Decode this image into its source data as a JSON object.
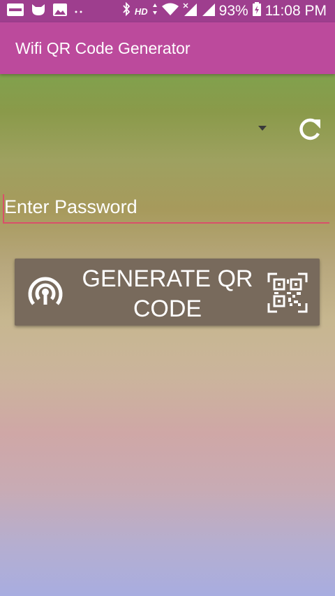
{
  "status_bar": {
    "battery": "93%",
    "time": "11:08 PM",
    "network_label": "HD",
    "icons": [
      "notification-icon",
      "cat-icon",
      "image-icon",
      "more-dots-icon",
      "bluetooth-icon",
      "data-arrows-icon",
      "wifi-signal-icon",
      "cell-signal-no-data-icon",
      "cell-signal-icon",
      "battery-icon"
    ]
  },
  "app_bar": {
    "title": "Wifi QR Code Generator",
    "color": "#bc4a9c"
  },
  "network_select": {
    "selected": "",
    "icon": "dropdown-arrow-icon"
  },
  "refresh": {
    "icon": "refresh-icon"
  },
  "password": {
    "value": "",
    "placeholder": "Enter Password",
    "accent": "#d9506a"
  },
  "generate_button": {
    "label": "GENERATE QR CODE",
    "left_icon": "wifi-hotspot-icon",
    "right_icon": "qr-scan-icon",
    "color": "#786a5c"
  }
}
